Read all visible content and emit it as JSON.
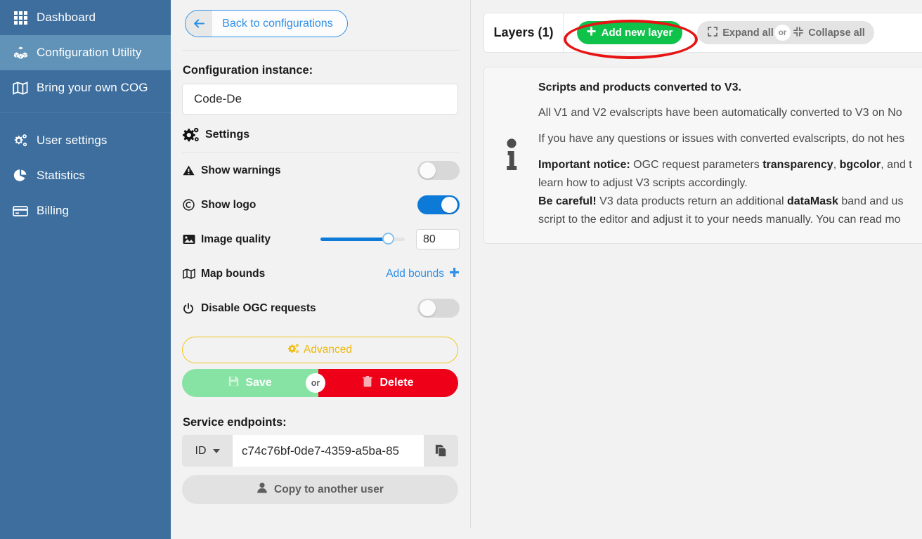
{
  "sidebar": {
    "items": [
      {
        "label": "Dashboard",
        "icon": "grid-icon",
        "active": false
      },
      {
        "label": "Configuration Utility",
        "icon": "cubes-icon",
        "active": true
      },
      {
        "label": "Bring your own COG",
        "icon": "map-icon",
        "active": false
      }
    ],
    "items2": [
      {
        "label": "User settings",
        "icon": "gears-icon"
      },
      {
        "label": "Statistics",
        "icon": "pie-chart-icon"
      },
      {
        "label": "Billing",
        "icon": "credit-card-icon"
      }
    ]
  },
  "config": {
    "back_label": "Back to configurations",
    "instance_title": "Configuration instance:",
    "instance_value": "Code-De",
    "settings_label": "Settings",
    "rows": {
      "show_warnings": {
        "label": "Show warnings",
        "state": "off"
      },
      "show_logo": {
        "label": "Show logo",
        "state": "on"
      },
      "image_quality": {
        "label": "Image quality",
        "value": "80",
        "percent": 80
      },
      "map_bounds": {
        "label": "Map bounds",
        "action": "Add bounds"
      },
      "disable_ogc": {
        "label": "Disable OGC requests",
        "state": "off"
      }
    },
    "advanced_label": "Advanced",
    "save_label": "Save",
    "or_label": "or",
    "delete_label": "Delete",
    "endpoints_title": "Service endpoints:",
    "endpoint_select": "ID",
    "endpoint_value": "c74c76bf-0de7-4359-a5ba-85",
    "copy_user_label": "Copy to another user"
  },
  "layers": {
    "title": "Layers (1)",
    "add_label": "Add new layer",
    "expand_label": "Expand all",
    "or_label": "or",
    "collapse_label": "Collapse all"
  },
  "notice": {
    "title": "Scripts and products converted to V3.",
    "line1": "All V1 and V2 evalscripts have been automatically converted to V3 on No",
    "line2": "If you have any questions or issues with converted evalscripts, do not hes",
    "line3_b1": "Important notice:",
    "line3_t1": " OGC request parameters ",
    "line3_b2": "transparency",
    "line3_t2": ", ",
    "line3_b3": "bgcolor",
    "line3_t3": ", and t",
    "line4": "learn how to adjust V3 scripts accordingly.",
    "line5_b1": "Be careful!",
    "line5_t1": " V3 data products return an additional ",
    "line5_b2": "dataMask",
    "line5_t2": " band and us",
    "line6": "script to the editor and adjust it to your needs manually. You can read mo"
  },
  "colors": {
    "sidebar_bg": "#3d6e9e",
    "sidebar_active": "#6193b8",
    "accent_blue": "#2e90e8",
    "toggle_on": "#0d7ad8",
    "green_save": "#87e3a4",
    "green_add": "#0ec24a",
    "red_delete": "#ed0018",
    "yellow_advanced": "#f5c518",
    "highlight_red": "#e81313"
  }
}
